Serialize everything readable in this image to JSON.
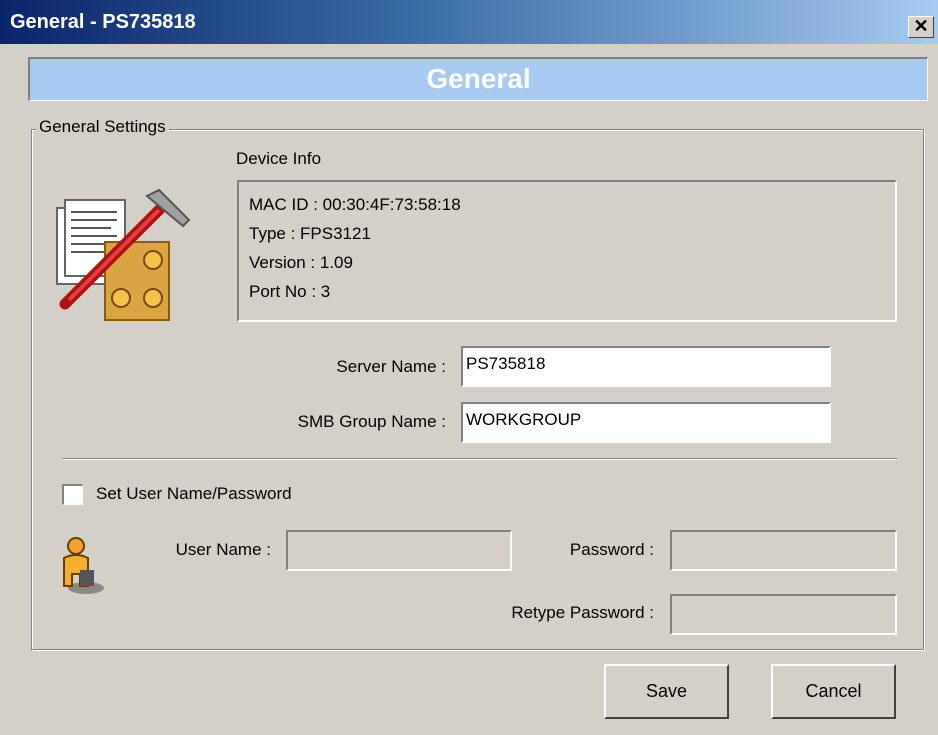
{
  "window": {
    "title": "General - PS735818",
    "close_glyph": "✕"
  },
  "banner": {
    "title": "General"
  },
  "group": {
    "legend": "General Settings"
  },
  "device_info": {
    "heading": "Device Info",
    "lines": [
      "MAC ID : 00:30:4F:73:58:18",
      "Type : FPS3121",
      "Version : 1.09",
      "Port No : 3"
    ]
  },
  "fields": {
    "server_name": {
      "label": "Server Name :",
      "value": "PS735818"
    },
    "smb_group": {
      "label": "SMB Group Name :",
      "value": "WORKGROUP"
    }
  },
  "auth": {
    "checkbox_label": "Set User Name/Password",
    "checked": false,
    "user_name_label": "User Name :",
    "user_name_value": "",
    "password_label": "Password :",
    "password_value": "",
    "retype_label": "Retype Password :",
    "retype_value": ""
  },
  "buttons": {
    "save": "Save",
    "cancel": "Cancel"
  },
  "icons": {
    "settings": "tools-settings-icon",
    "user": "user-icon"
  },
  "colors": {
    "title_start": "#0a246a",
    "title_end": "#a6caf0",
    "banner": "#a6caf0",
    "face": "#d4d0c8"
  }
}
